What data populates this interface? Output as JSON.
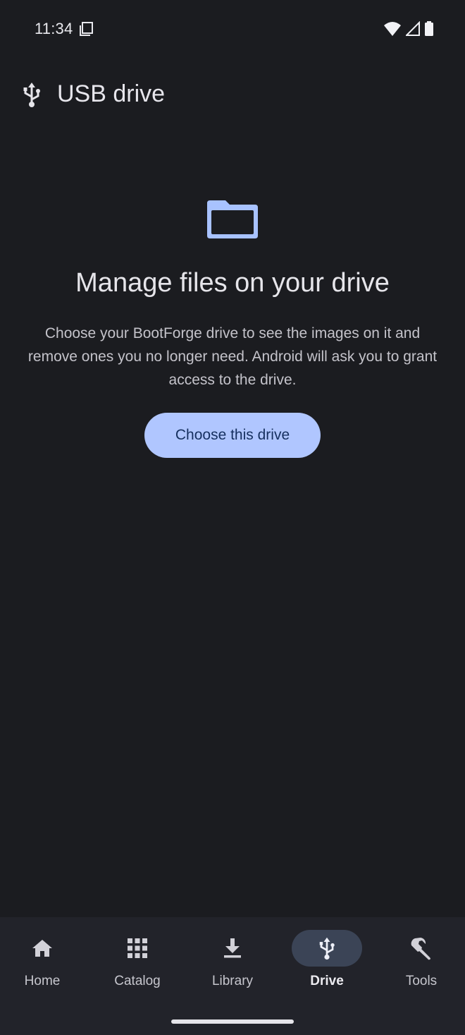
{
  "status_bar": {
    "time": "11:34",
    "notification_icon": "screen-icon",
    "wifi_icon": "wifi-icon",
    "signal_icon": "cell-signal-icon",
    "battery_icon": "battery-icon"
  },
  "app_bar": {
    "icon": "usb-icon",
    "title": "USB drive"
  },
  "empty_state": {
    "icon": "folder-icon",
    "title": "Manage files on your drive",
    "description": "Choose your BootForge drive to see the images on it and remove ones you no longer need. Android will ask you to grant access to the drive.",
    "button_label": "Choose this drive"
  },
  "bottom_nav": {
    "items": [
      {
        "label": "Home",
        "icon": "home-icon",
        "active": false
      },
      {
        "label": "Catalog",
        "icon": "grid-icon",
        "active": false
      },
      {
        "label": "Library",
        "icon": "download-icon",
        "active": false
      },
      {
        "label": "Drive",
        "icon": "usb-icon",
        "active": true
      },
      {
        "label": "Tools",
        "icon": "wrench-icon",
        "active": false
      }
    ]
  },
  "colors": {
    "background": "#1b1c20",
    "nav_background": "#22232a",
    "accent": "#b0c6ff",
    "active_pill": "#3b4456"
  }
}
